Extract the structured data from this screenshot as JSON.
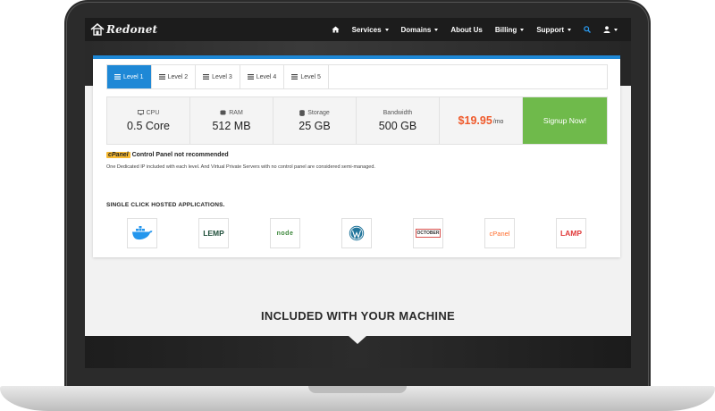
{
  "brand": {
    "logo_text": "Redonet"
  },
  "nav": {
    "items": [
      {
        "label": "Services",
        "dropdown": true
      },
      {
        "label": "Domains",
        "dropdown": true
      },
      {
        "label": "About Us",
        "dropdown": false
      },
      {
        "label": "Billing",
        "dropdown": true
      },
      {
        "label": "Support",
        "dropdown": true
      }
    ]
  },
  "icons": {
    "home": "home-icon",
    "search": "search-icon",
    "user": "user-icon",
    "tab": "list-icon",
    "cpu": "monitor-icon",
    "ram": "memory-icon",
    "storage": "database-icon"
  },
  "tabs": [
    {
      "label": "Level 1",
      "active": true
    },
    {
      "label": "Level 2",
      "active": false
    },
    {
      "label": "Level 3",
      "active": false
    },
    {
      "label": "Level 4",
      "active": false
    },
    {
      "label": "Level 5",
      "active": false
    }
  ],
  "specs": {
    "cpu": {
      "label": "CPU",
      "value": "0.5 Core"
    },
    "ram": {
      "label": "RAM",
      "value": "512 MB"
    },
    "storage": {
      "label": "Storage",
      "value": "25 GB"
    },
    "bandwidth": {
      "label": "Bandwidth",
      "value": "500 GB"
    }
  },
  "price": {
    "amount": "$19.95",
    "unit": "/mo"
  },
  "signup_label": "Signup Now!",
  "cpanel": {
    "tag": "cPanel",
    "text": "Control Panel not recommended"
  },
  "ip_note": "One Dedicated IP included with each level. And Virtual Private Servers with no control panel are considered semi-managed.",
  "apps_title": "SINGLE CLICK HOSTED APPLICATIONS.",
  "apps": [
    {
      "name": "docker",
      "label": ""
    },
    {
      "name": "lemp",
      "label": "LEMP"
    },
    {
      "name": "nodejs",
      "label": "node"
    },
    {
      "name": "wordpress",
      "label": ""
    },
    {
      "name": "october",
      "label": "OCTOBER"
    },
    {
      "name": "cpanel",
      "label": "cPanel"
    },
    {
      "name": "lamp",
      "label": "LAMP"
    }
  ],
  "included_title": "INCLUDED WITH YOUR MACHINE",
  "colors": {
    "accent": "#1e88d6",
    "signup": "#6fba4b",
    "price": "#ef5a2b",
    "cpanel_tag": "#f6b933",
    "navbar": "#1c1c1c"
  }
}
